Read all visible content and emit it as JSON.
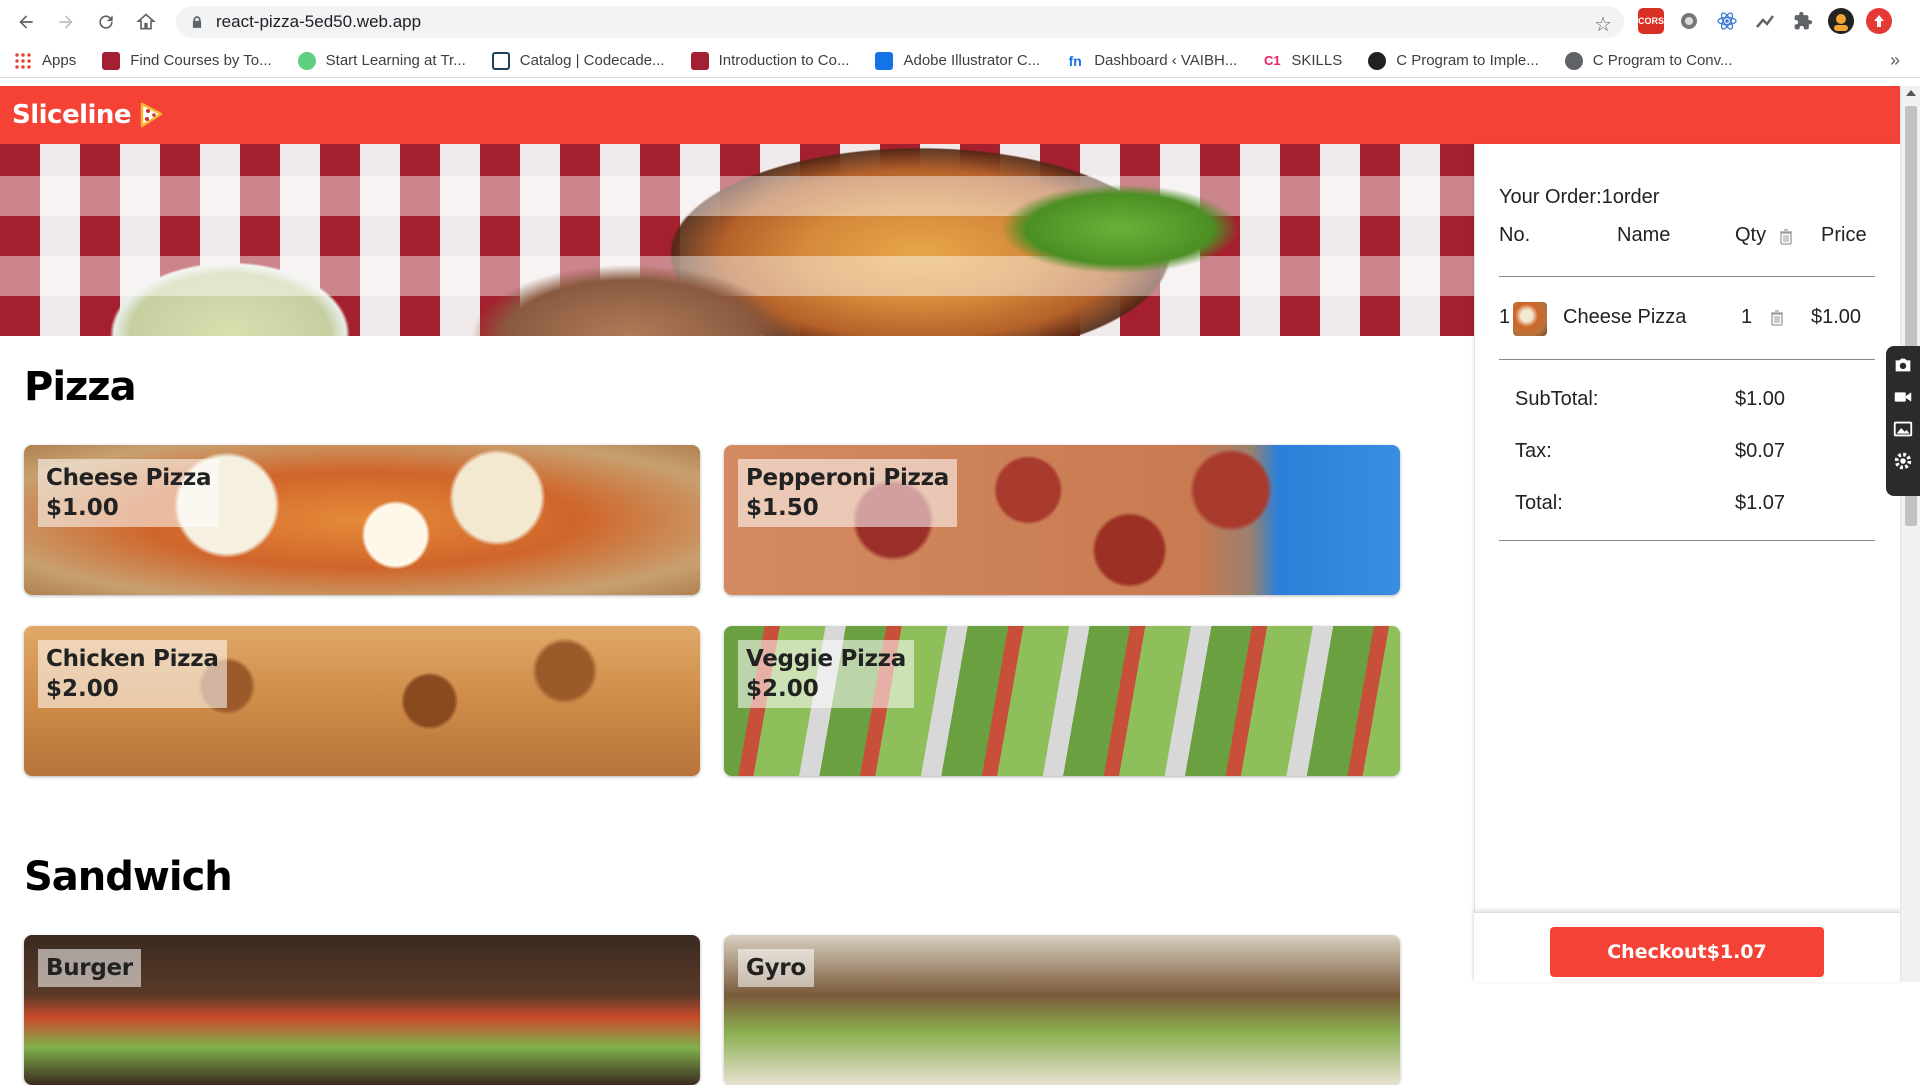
{
  "browser": {
    "url": "react-pizza-5ed50.web.app",
    "bookmarks": [
      {
        "label": "Apps",
        "icon": "apps-grid-icon",
        "color": "#ea4335"
      },
      {
        "label": "Find Courses by To...",
        "icon": "mit-icon",
        "color": "#a31f34"
      },
      {
        "label": "Start Learning at Tr...",
        "icon": "treehouse-icon",
        "color": "#5fcf80"
      },
      {
        "label": "Catalog | Codecade...",
        "icon": "codecademy-icon",
        "color": "#1f4056"
      },
      {
        "label": "Introduction to Co...",
        "icon": "mit-icon",
        "color": "#a31f34"
      },
      {
        "label": "Adobe Illustrator C...",
        "icon": "adobe-icon",
        "color": "#1473e6"
      },
      {
        "label": "Dashboard ‹ VAIBH...",
        "icon": "fn-icon",
        "color": "#1a73e8"
      },
      {
        "label": "SKILLS",
        "icon": "c1-icon",
        "color": "#e91e63"
      },
      {
        "label": "C Program to Imple...",
        "icon": "github-icon",
        "color": "#202124"
      },
      {
        "label": "C Program to Conv...",
        "icon": "globe-icon",
        "color": "#5f6368"
      }
    ]
  },
  "site": {
    "logo": "Sliceline",
    "brand_color": "#f44336"
  },
  "menu": {
    "sections": [
      {
        "title": "Pizza",
        "items": [
          {
            "name": "Cheese Pizza",
            "price": "$1.00"
          },
          {
            "name": "Pepperoni Pizza",
            "price": "$1.50"
          },
          {
            "name": "Chicken Pizza",
            "price": "$2.00"
          },
          {
            "name": "Veggie Pizza",
            "price": "$2.00"
          }
        ]
      },
      {
        "title": "Sandwich",
        "items": [
          {
            "name": "Burger",
            "price": ""
          },
          {
            "name": "Gyro",
            "price": ""
          }
        ]
      }
    ]
  },
  "order": {
    "title": "Your Order:1order",
    "headers": {
      "no": "No.",
      "name": "Name",
      "qty": "Qty",
      "price": "Price"
    },
    "items": [
      {
        "no": "1",
        "name": "Cheese Pizza",
        "qty": "1",
        "price": "$1.00"
      }
    ],
    "subtotal_label": "SubTotal:",
    "subtotal": "$1.00",
    "tax_label": "Tax:",
    "tax": "$0.07",
    "total_label": "Total:",
    "total": "$1.07",
    "checkout_label": "Checkout$1.07"
  }
}
